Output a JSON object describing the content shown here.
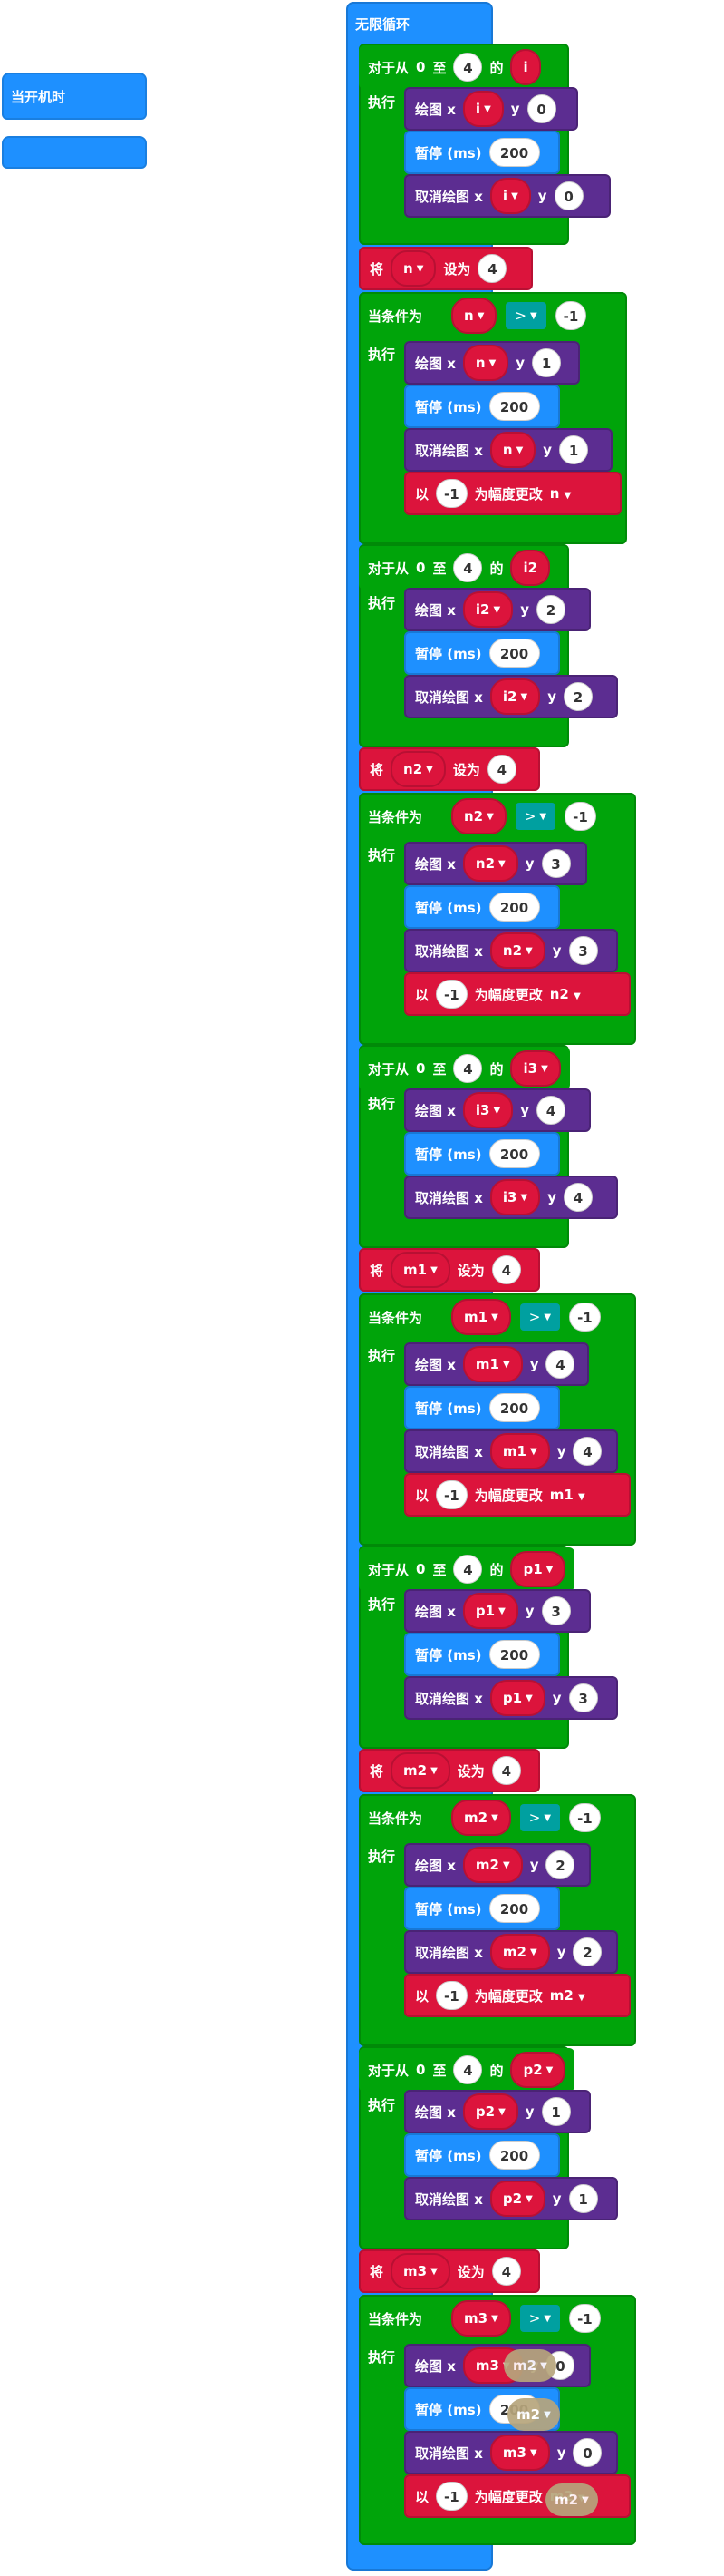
{
  "blocks": {
    "on_start": "当开机时",
    "forever": "无限循环",
    "for_prefix": "对于从",
    "for_mid": "至",
    "for_of": "的",
    "do": "执行",
    "plot": "绘图 x",
    "unplot": "取消绘图 x",
    "y": "y",
    "pause": "暂停 (ms)",
    "set": "将",
    "set_to": "设为",
    "while": "当条件为",
    "gt": ">",
    "change_by": "以",
    "change_suffix": "为幅度更改"
  },
  "values": {
    "zero": "0",
    "four": "4",
    "pause_ms": "200",
    "neg_one": "-1",
    "y0": "0",
    "y1": "1",
    "y2": "2",
    "y3": "3",
    "y4": "4"
  },
  "vars": {
    "i": "i",
    "n": "n",
    "i2": "i2",
    "n2": "n2",
    "i3": "i3",
    "m1": "m1",
    "p1": "p1",
    "m2": "m2",
    "p2": "p2",
    "m3": "m3"
  },
  "dropdown_icon": "caret-down-icon",
  "colors": {
    "event": "#1e90ff",
    "loop": "#00a40a",
    "variable": "#dc143c",
    "led": "#5c2d91",
    "logic": "#00a0a0",
    "drag_ghost": "#b7a57c"
  }
}
